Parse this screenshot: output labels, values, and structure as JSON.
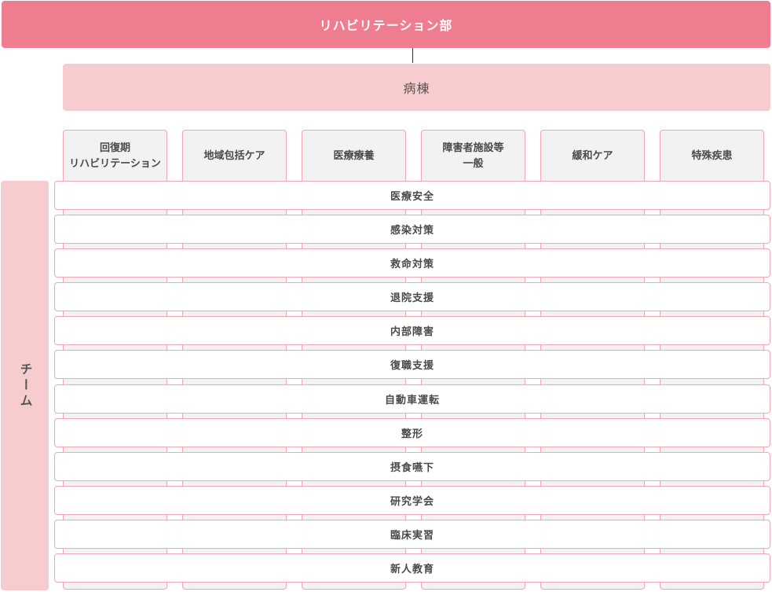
{
  "header": {
    "title": "リハビリテーション部"
  },
  "ward": {
    "label": "病棟"
  },
  "columns": [
    {
      "label": "回復期\nリハビリテーション"
    },
    {
      "label": "地域包括ケア"
    },
    {
      "label": "医療療養"
    },
    {
      "label": "障害者施設等\n一般"
    },
    {
      "label": "緩和ケア"
    },
    {
      "label": "特殊疾患"
    }
  ],
  "team": {
    "label": "チーム",
    "rows": [
      "医療安全",
      "感染対策",
      "救命対策",
      "退院支援",
      "内部障害",
      "復職支援",
      "自動車運転",
      "整形",
      "摂食嚥下",
      "研究学会",
      "臨床実習",
      "新人教育"
    ]
  },
  "colors": {
    "header": "#ee7d8f",
    "ward": "#f6ccce",
    "column_bg": "#f2f2f2",
    "border": "#f0a8b2"
  }
}
